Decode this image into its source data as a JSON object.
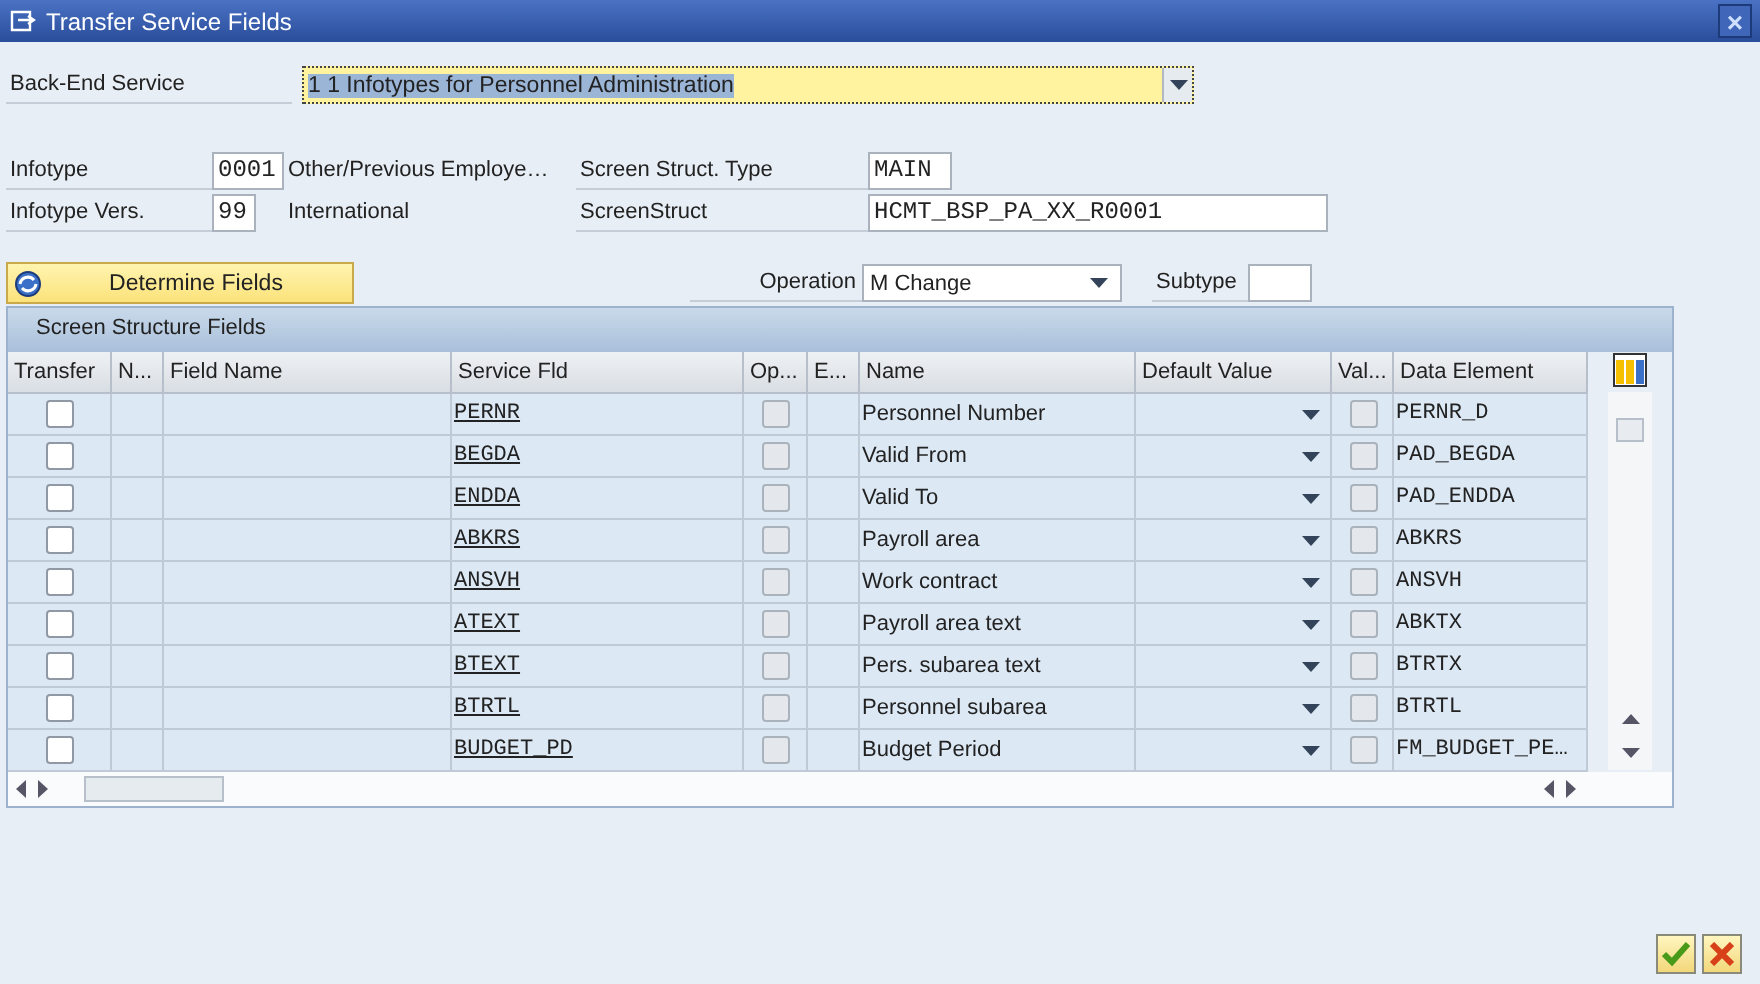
{
  "window": {
    "title": "Transfer Service Fields",
    "close": "×"
  },
  "backend_service": {
    "label": "Back-End Service",
    "value": "1 1 Infotypes for Personnel Administration"
  },
  "infotype": {
    "label": "Infotype",
    "value": "0001",
    "description": "Other/Previous Employe…"
  },
  "infotype_version": {
    "label": "Infotype Vers.",
    "value": "99",
    "description": "International"
  },
  "screen_struct_type": {
    "label": "Screen Struct. Type",
    "value": "MAIN"
  },
  "screen_struct": {
    "label": "ScreenStruct",
    "value": "HCMT_BSP_PA_XX_R0001"
  },
  "determine_button": {
    "label": "Determine Fields"
  },
  "operation": {
    "label": "Operation",
    "value": "M Change"
  },
  "subtype": {
    "label": "Subtype"
  },
  "table": {
    "title": "Screen Structure Fields",
    "columns": [
      "Transfer",
      "N...",
      "Field Name",
      "Service Fld",
      "Op...",
      "E...",
      "Name",
      "Default Value",
      "Val...",
      "Data Element"
    ],
    "rows": [
      {
        "transfer": false,
        "service_field": "PERNR",
        "optional": false,
        "name": "Personnel Number",
        "value_check": false,
        "data_element": "PERNR_D"
      },
      {
        "transfer": false,
        "service_field": "BEGDA",
        "optional": false,
        "name": "Valid From",
        "value_check": false,
        "data_element": "PAD_BEGDA"
      },
      {
        "transfer": false,
        "service_field": "ENDDA",
        "optional": false,
        "name": "Valid To",
        "value_check": false,
        "data_element": "PAD_ENDDA"
      },
      {
        "transfer": false,
        "service_field": "ABKRS",
        "optional": false,
        "name": "Payroll area",
        "value_check": false,
        "data_element": "ABKRS"
      },
      {
        "transfer": false,
        "service_field": "ANSVH",
        "optional": false,
        "name": "Work contract",
        "value_check": false,
        "data_element": "ANSVH"
      },
      {
        "transfer": false,
        "service_field": "ATEXT",
        "optional": false,
        "name": "Payroll area text",
        "value_check": false,
        "data_element": "ABKTX"
      },
      {
        "transfer": false,
        "service_field": "BTEXT",
        "optional": false,
        "name": "Pers. subarea text",
        "value_check": false,
        "data_element": "BTRTX"
      },
      {
        "transfer": false,
        "service_field": "BTRTL",
        "optional": false,
        "name": "Personnel subarea",
        "value_check": false,
        "data_element": "BTRTL"
      },
      {
        "transfer": false,
        "service_field": "BUDGET_PD",
        "optional": false,
        "name": "Budget Period",
        "value_check": false,
        "data_element": "FM_BUDGET_PE…"
      }
    ]
  }
}
